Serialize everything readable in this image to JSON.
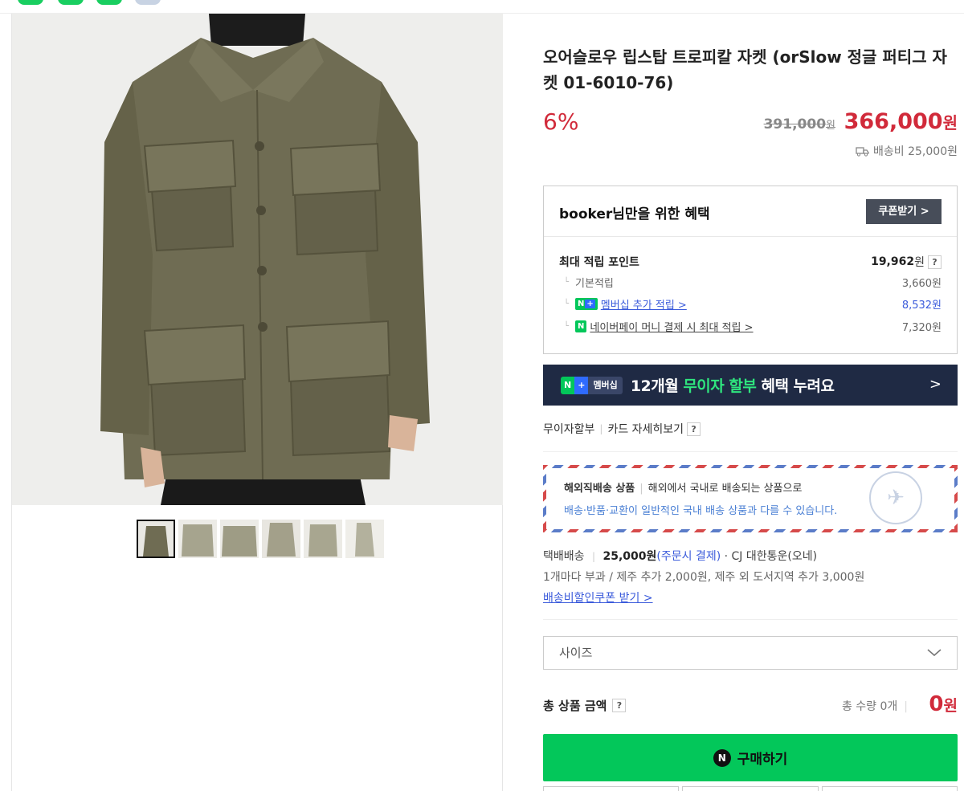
{
  "top_strip": {
    "colors": [
      "#19ce60",
      "#19ce60",
      "#19ce60",
      "#c8d3e3"
    ]
  },
  "product": {
    "title": "오어슬로우 립스탑 트로피칼 자켓 (orSlow 정글 퍼티그 자켓 01-6010-76)",
    "discount": "6%",
    "original_price": "391,000",
    "original_price_unit": "원",
    "price": "366,000",
    "price_unit": "원",
    "shipping_fee": "배송비 25,000원",
    "thumbnail_count": 6
  },
  "benefit": {
    "title": "booker님만을 위한 혜택",
    "coupon_button": "쿠폰받기 >",
    "max_points_label": "최대 적립 포인트",
    "max_points_value": "19,962",
    "max_points_unit": "원",
    "help": "?",
    "rows": [
      {
        "label": "기본적립",
        "value": "3,660원"
      },
      {
        "label": "멤버십 추가 적립 >",
        "value": "8,532원"
      },
      {
        "label": "네이버페이 머니 결제 시 최대 적립 >",
        "value": "7,320원"
      }
    ]
  },
  "membership_banner": {
    "badge_n": "N",
    "badge_plus": "+",
    "badge_text": "멤버십",
    "text_before": "12개월 ",
    "text_highlight": "무이자 할부",
    "text_after": " 혜택 누려요",
    "arrow": ">"
  },
  "installment": {
    "label": "무이자할부",
    "sep": "|",
    "card_detail": "카드 자세히보기",
    "help": "?"
  },
  "overseas": {
    "label": "해외직배송 상품",
    "sep": "|",
    "desc": "해외에서 국내로 배송되는 상품으로",
    "notice": "배송·반품·교환이 일반적인 국내 배송 상품과 다를 수 있습니다."
  },
  "delivery": {
    "method": "택배배송",
    "sep": "|",
    "price": "25,000원",
    "payment_timing": "(주문시 결제)",
    "carrier": "· CJ 대한통운(오네)",
    "extra": "1개마다 부과 / 제주 추가 2,000원, 제주 외 도서지역 추가 3,000원",
    "coupon_link": "배송비할인쿠폰 받기 >"
  },
  "size_select": {
    "placeholder": "사이즈"
  },
  "total": {
    "label": "총 상품 금액",
    "help": "?",
    "quantity": "총 수량 0개",
    "sep": "|",
    "price": "0",
    "price_unit": "원"
  },
  "buy_button": {
    "label": "구매하기",
    "logo": "N"
  }
}
